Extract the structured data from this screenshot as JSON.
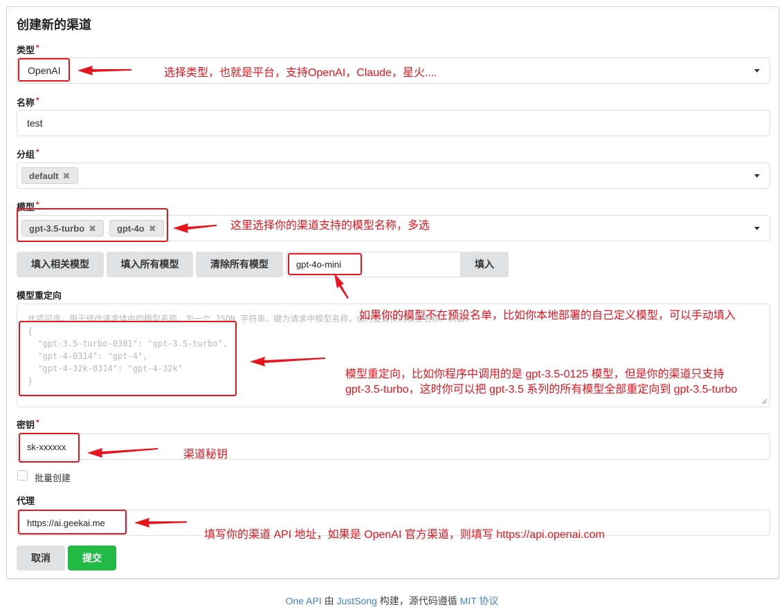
{
  "form": {
    "title": "创建新的渠道",
    "required_mark": "*",
    "type": {
      "label": "类型",
      "value": "OpenAI"
    },
    "name": {
      "label": "名称",
      "value": "test"
    },
    "group": {
      "label": "分组",
      "tags": [
        "default"
      ]
    },
    "models": {
      "label": "模型",
      "tags": [
        "gpt-3.5-turbo",
        "gpt-4o"
      ],
      "buttons": {
        "fill_related": "填入相关模型",
        "fill_all": "填入所有模型",
        "clear_all": "清除所有模型"
      },
      "custom_input_value": "gpt-4o-mini",
      "fill_button": "填入"
    },
    "model_mapping": {
      "label": "模型重定向",
      "placeholder_lines": [
        "此项可选，用于修改请求体中的模型名称，为一个 JSON 字符串，键为请求中模型名称，值为要替换的模型名称，例如：",
        "{",
        "  \"gpt-3.5-turbo-0301\": \"gpt-3.5-turbo\",",
        "  \"gpt-4-0314\": \"gpt-4\",",
        "  \"gpt-4-32k-0314\": \"gpt-4-32k\"",
        "}"
      ]
    },
    "key": {
      "label": "密钥",
      "value": "sk-xxxxxx"
    },
    "batch_create": {
      "label": "批量创建",
      "checked": false
    },
    "proxy": {
      "label": "代理",
      "value": "https://ai.geekai.me"
    },
    "cancel_button": "取消",
    "submit_button": "提交"
  },
  "annotations": {
    "type": "选择类型，也就是平台，支持OpenAI，Claude，星火....",
    "models": "这里选择你的渠道支持的模型名称，多选",
    "custom_model": "如果你的模型不在预设名单，比如你本地部署的自己定义模型，可以手动填入",
    "mapping_line1": "模型重定向，比如你程序中调用的是 gpt-3.5-0125 模型，但是你的渠道只支持",
    "mapping_line2": "gpt-3.5-turbo，这时你可以把 gpt-3.5 系列的所有模型全部重定向到 gpt-3.5-turbo",
    "key": "渠道秘钥",
    "proxy": "填写你的渠道 API 地址，如果是 OpenAI 官方渠道，则填写 https://api.openai.com"
  },
  "footer": {
    "app": "One API",
    "by": " 由 ",
    "author": "JustSong",
    "built": " 构建，源代码遵循 ",
    "license": "MIT 协议"
  },
  "colors": {
    "annotation": "#e8141e",
    "submit": "#21ba45",
    "link": "#4183c4"
  }
}
